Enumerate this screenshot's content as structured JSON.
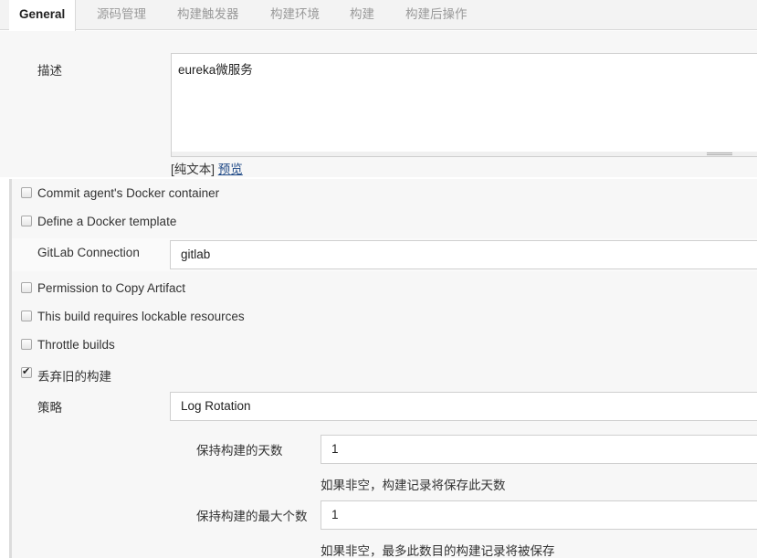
{
  "tabs": [
    {
      "label": "General"
    },
    {
      "label": "源码管理"
    },
    {
      "label": "构建触发器"
    },
    {
      "label": "构建环境"
    },
    {
      "label": "构建"
    },
    {
      "label": "构建后操作"
    }
  ],
  "description": {
    "label": "描述",
    "value": "eureka微服务",
    "format_prefix": "[纯文本]",
    "preview_link": "预览"
  },
  "options": [
    {
      "label": "Commit agent's Docker container",
      "checked": false
    },
    {
      "label": "Define a Docker template",
      "checked": false
    },
    {
      "label": "Permission to Copy Artifact",
      "checked": false
    },
    {
      "label": "This build requires lockable resources",
      "checked": false
    },
    {
      "label": "Throttle builds",
      "checked": false
    },
    {
      "label": "丢弃旧的构建",
      "checked": true
    }
  ],
  "gitlab": {
    "label": "GitLab Connection",
    "value": "gitlab"
  },
  "discard": {
    "strategy_label": "策略",
    "strategy_value": "Log Rotation",
    "days_label": "保持构建的天数",
    "days_value": "1",
    "days_hint": "如果非空，构建记录将保存此天数",
    "max_label": "保持构建的最大个数",
    "max_value": "1",
    "max_hint": "如果非空，最多此数目的构建记录将被保存"
  }
}
